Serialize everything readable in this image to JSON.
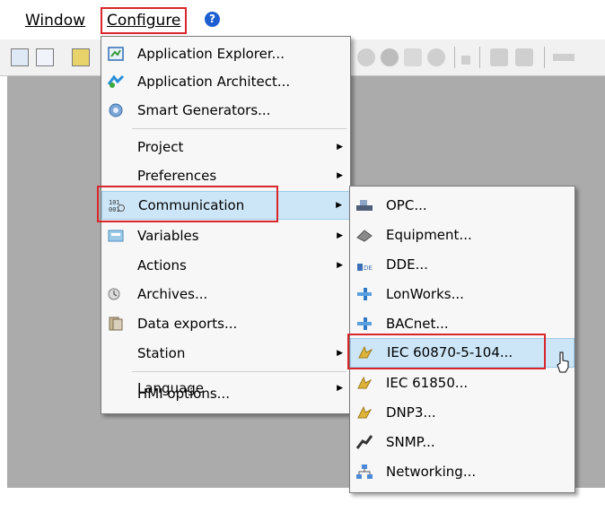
{
  "menubar": {
    "window_label": "Window",
    "configure_label": "Configure",
    "help_icon_glyph": "?"
  },
  "configure_menu": {
    "items": [
      {
        "label": "Application Explorer...",
        "icon": "application-explorer-icon"
      },
      {
        "label": "Application Architect...",
        "icon": "application-architect-icon"
      },
      {
        "label": "Smart Generators...",
        "icon": "smart-generators-icon"
      },
      {
        "label": "Project"
      },
      {
        "label": "Preferences"
      },
      {
        "label": "Communication",
        "icon": "communication-icon"
      },
      {
        "label": "Variables",
        "icon": "variables-icon"
      },
      {
        "label": "Actions"
      },
      {
        "label": "Archives...",
        "icon": "archives-icon"
      },
      {
        "label": "Data exports...",
        "icon": "data-exports-icon"
      },
      {
        "label": "Station"
      },
      {
        "label": "Language"
      },
      {
        "label": "HMI options..."
      }
    ]
  },
  "communication_submenu": {
    "items": [
      {
        "label": "OPC...",
        "icon": "opc-icon"
      },
      {
        "label": "Equipment...",
        "icon": "equipment-icon"
      },
      {
        "label": "DDE...",
        "icon": "dde-icon"
      },
      {
        "label": "LonWorks...",
        "icon": "lonworks-icon"
      },
      {
        "label": "BACnet...",
        "icon": "bacnet-icon"
      },
      {
        "label": "IEC 60870-5-104...",
        "icon": "iec-60870-icon"
      },
      {
        "label": "IEC 61850...",
        "icon": "iec-61850-icon"
      },
      {
        "label": "DNP3...",
        "icon": "dnp3-icon"
      },
      {
        "label": "SNMP...",
        "icon": "snmp-icon"
      },
      {
        "label": "Networking...",
        "icon": "networking-icon"
      }
    ]
  },
  "colors": {
    "highlight_box": "#d9262b",
    "menu_hover": "#cde6f7",
    "workspace": "#ababab"
  }
}
